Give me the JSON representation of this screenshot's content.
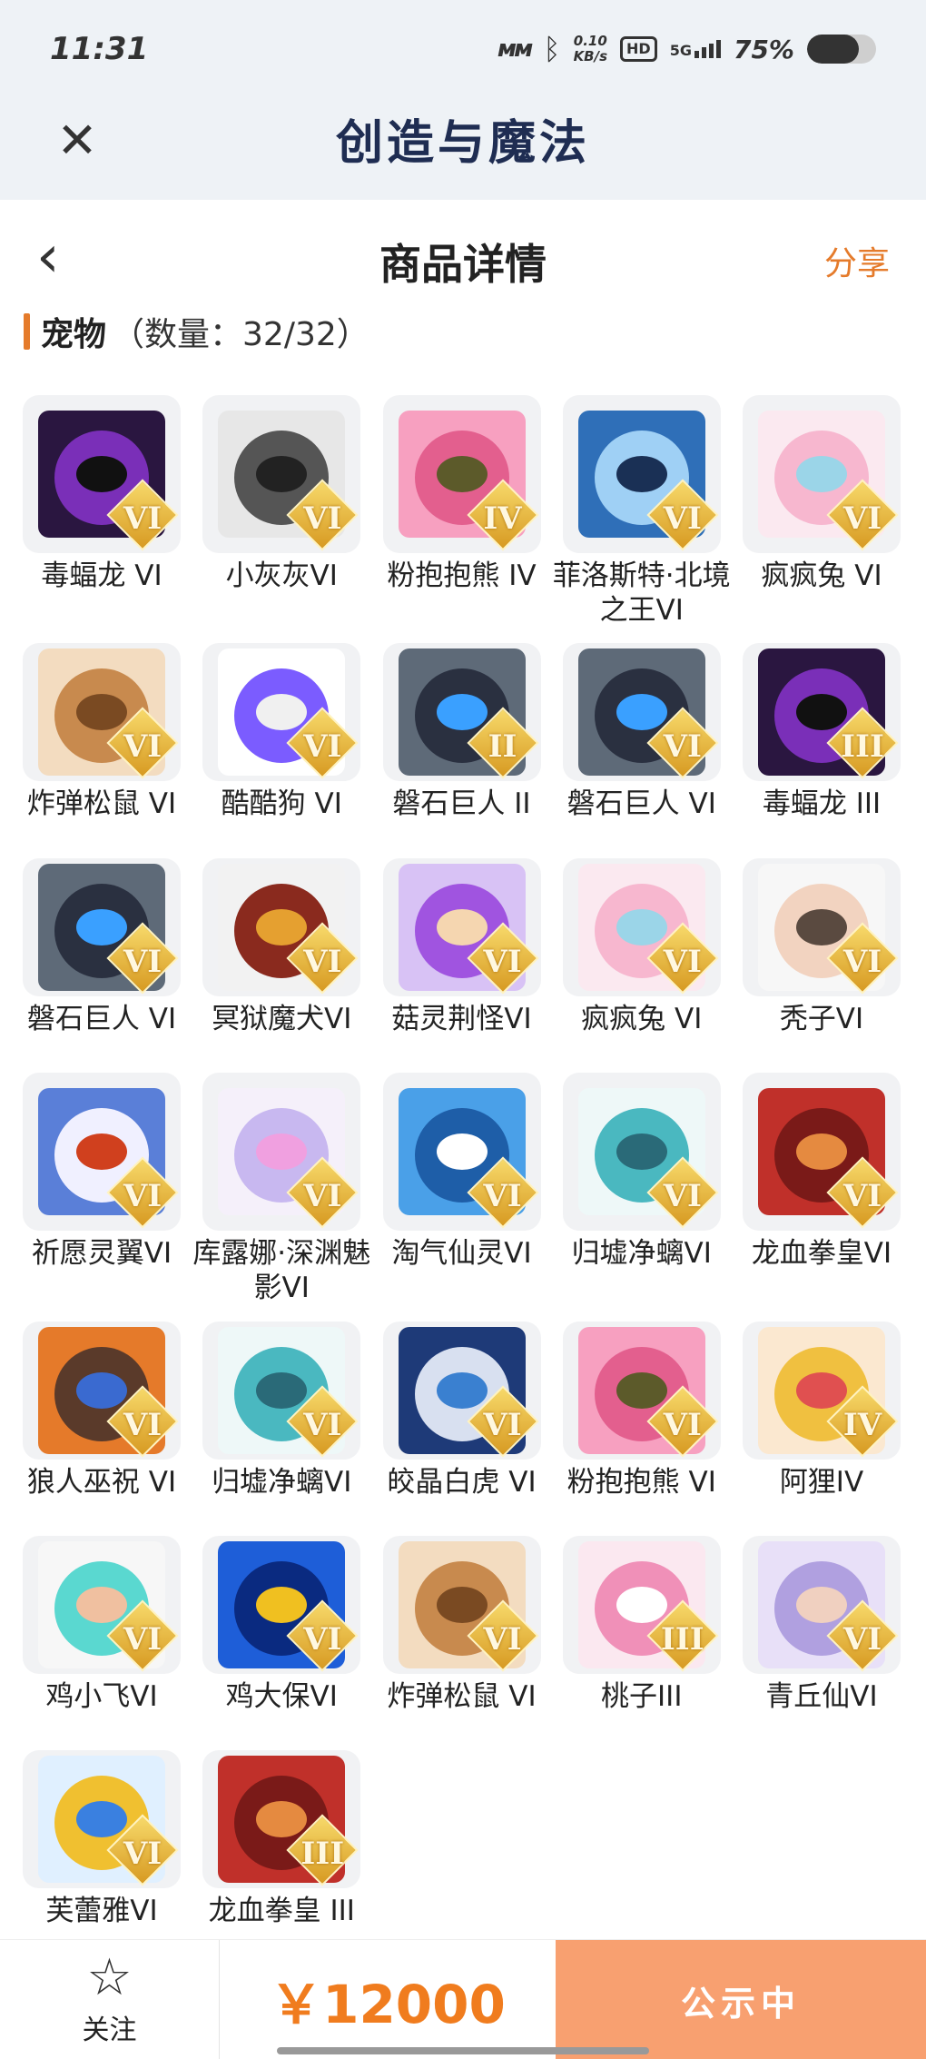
{
  "status_bar": {
    "time": "11:31",
    "signal_label": "ᴍᴍ",
    "bluetooth_icon": "bluetooth-icon",
    "net_speed_value": "0.10",
    "net_speed_unit": "KB/s",
    "hd_label": "HD",
    "network_label": "5G",
    "battery_percent": "75%",
    "battery_level": 0.75
  },
  "app_header": {
    "close_icon": "close-icon",
    "title": "创造与魔法"
  },
  "page_header": {
    "back_icon": "chevron-left-icon",
    "title": "商品详情",
    "share_label": "分享"
  },
  "section": {
    "name": "宠物",
    "count_text": "（数量：32/32）"
  },
  "pets": [
    {
      "name": "毒蝠龙 VI",
      "rank": "VI",
      "colors": [
        "#2a1640",
        "#7a2fb8",
        "#111"
      ]
    },
    {
      "name": "小灰灰VI",
      "rank": "VI",
      "colors": [
        "#e7e7e7",
        "#555555",
        "#222"
      ]
    },
    {
      "name": "粉抱抱熊 IV",
      "rank": "IV",
      "colors": [
        "#f7a0c0",
        "#e35f8e",
        "#5c5a2a"
      ]
    },
    {
      "name": "菲洛斯特·北境之王VI",
      "rank": "VI",
      "colors": [
        "#2f6fb8",
        "#9fd0f5",
        "#1a3055"
      ]
    },
    {
      "name": "疯疯兔 VI",
      "rank": "VI",
      "colors": [
        "#fbe9f0",
        "#f7b7cf",
        "#9bd5e8"
      ]
    },
    {
      "name": "炸弹松鼠 VI",
      "rank": "VI",
      "colors": [
        "#f3dcc0",
        "#c88a4e",
        "#7a4a22"
      ]
    },
    {
      "name": "酷酷狗 VI",
      "rank": "VI",
      "colors": [
        "#ffffff",
        "#7b5cff",
        "#f0f0f0"
      ]
    },
    {
      "name": "磐石巨人 II",
      "rank": "II",
      "colors": [
        "#5e6a78",
        "#2a3040",
        "#3aa0ff"
      ]
    },
    {
      "name": "磐石巨人 VI",
      "rank": "VI",
      "colors": [
        "#5e6a78",
        "#2a3040",
        "#3aa0ff"
      ]
    },
    {
      "name": "毒蝠龙 III",
      "rank": "III",
      "colors": [
        "#2a1640",
        "#7a2fb8",
        "#111"
      ]
    },
    {
      "name": "磐石巨人 VI",
      "rank": "VI",
      "colors": [
        "#5e6a78",
        "#2a3040",
        "#3aa0ff"
      ]
    },
    {
      "name": "冥狱魔犬VI",
      "rank": "VI",
      "colors": [
        "#f2f2f2",
        "#8a2a1e",
        "#e5a030"
      ]
    },
    {
      "name": "菇灵荆怪VI",
      "rank": "VI",
      "colors": [
        "#d8c2f5",
        "#a054e0",
        "#f5d6b0"
      ]
    },
    {
      "name": "疯疯兔 VI",
      "rank": "VI",
      "colors": [
        "#fbe9f0",
        "#f7b7cf",
        "#9bd5e8"
      ]
    },
    {
      "name": "秃子VI",
      "rank": "VI",
      "colors": [
        "#f7f7f7",
        "#f2d3c0",
        "#5a4a40"
      ]
    },
    {
      "name": "祈愿灵翼VI",
      "rank": "VI",
      "colors": [
        "#5a7fd8",
        "#f0f0ff",
        "#d0401e"
      ]
    },
    {
      "name": "库露娜·深渊魅影VI",
      "rank": "VI",
      "colors": [
        "#f5f0fa",
        "#c8b8f0",
        "#f0a0e0"
      ]
    },
    {
      "name": "淘气仙灵VI",
      "rank": "VI",
      "colors": [
        "#4aa0e8",
        "#1e5ea8",
        "#ffffff"
      ]
    },
    {
      "name": "归墟净螭VI",
      "rank": "VI",
      "colors": [
        "#eef8f8",
        "#4ab8c0",
        "#2a6a78"
      ]
    },
    {
      "name": "龙血拳皇VI",
      "rank": "VI",
      "colors": [
        "#c0302a",
        "#7a1a18",
        "#e58a40"
      ]
    },
    {
      "name": "狼人巫祝 VI",
      "rank": "VI",
      "colors": [
        "#e57a2a",
        "#5a3a2a",
        "#3a6ad0"
      ]
    },
    {
      "name": "归墟净螭VI",
      "rank": "VI",
      "colors": [
        "#eef8f8",
        "#4ab8c0",
        "#2a6a78"
      ]
    },
    {
      "name": "皎晶白虎 VI",
      "rank": "VI",
      "colors": [
        "#1e3a78",
        "#d8e0f0",
        "#3a80d0"
      ]
    },
    {
      "name": "粉抱抱熊 VI",
      "rank": "VI",
      "colors": [
        "#f7a0c0",
        "#e35f8e",
        "#5c5a2a"
      ]
    },
    {
      "name": "阿狸IV",
      "rank": "IV",
      "colors": [
        "#fbe8d0",
        "#f0c040",
        "#e05050"
      ]
    },
    {
      "name": "鸡小飞VI",
      "rank": "VI",
      "colors": [
        "#f7f7f7",
        "#5ad8d0",
        "#f0c0a0"
      ]
    },
    {
      "name": "鸡大保VI",
      "rank": "VI",
      "colors": [
        "#1e5ed8",
        "#0a2a80",
        "#f0c020"
      ]
    },
    {
      "name": "炸弹松鼠 VI",
      "rank": "VI",
      "colors": [
        "#f3dcc0",
        "#c88a4e",
        "#7a4a22"
      ]
    },
    {
      "name": "桃子III",
      "rank": "III",
      "colors": [
        "#fbe8f0",
        "#f090b8",
        "#ffffff"
      ]
    },
    {
      "name": "青丘仙VI",
      "rank": "VI",
      "colors": [
        "#e8e0f8",
        "#b0a0e0",
        "#f0d0c0"
      ]
    },
    {
      "name": "芙蕾雅VI",
      "rank": "VI",
      "colors": [
        "#e0f0ff",
        "#f0c030",
        "#3a80e0"
      ]
    },
    {
      "name": "龙血拳皇 III",
      "rank": "III",
      "colors": [
        "#c0302a",
        "#7a1a18",
        "#e58a40"
      ]
    }
  ],
  "bottom_bar": {
    "follow_icon": "star-icon",
    "follow_label": "关注",
    "price": "￥12000",
    "status_label": "公示中"
  }
}
